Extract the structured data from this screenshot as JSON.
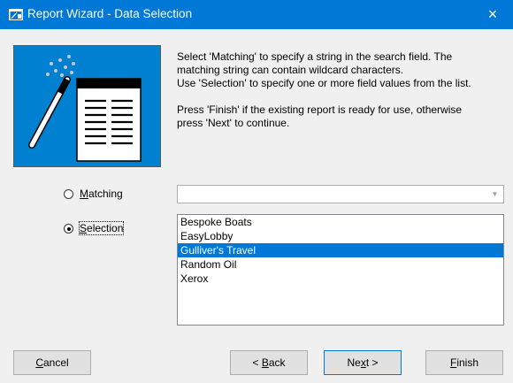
{
  "window": {
    "title": "Report Wizard - Data Selection",
    "close_glyph": "×"
  },
  "description": {
    "line1": "Select 'Matching' to specify a string in the search field.  The",
    "line2": "matching string can contain wildcard characters.",
    "line3": "Use 'Selection' to specify one or more field values from the list.",
    "line4": "Press 'Finish' if the existing report is ready for use, otherwise",
    "line5": "press 'Next' to continue."
  },
  "options": {
    "matching": {
      "label_pre": "",
      "label_u": "M",
      "label_post": "atching",
      "checked": false
    },
    "selection": {
      "label_pre": "",
      "label_u": "S",
      "label_post": "election",
      "checked": true
    }
  },
  "matching_combo": {
    "value": ""
  },
  "selection_list": {
    "items": [
      "Bespoke Boats",
      "EasyLobby",
      "Gulliver's Travel",
      "Random Oil",
      "Xerox"
    ],
    "selected_index": 2
  },
  "buttons": {
    "cancel": {
      "pre": "",
      "u": "C",
      "post": "ancel"
    },
    "back": {
      "pre": "< ",
      "u": "B",
      "post": "ack"
    },
    "next": {
      "pre": "Ne",
      "u": "x",
      "post": "t >"
    },
    "finish": {
      "pre": "",
      "u": "F",
      "post": "inish"
    }
  },
  "icons": {
    "app": "wizard-app-icon",
    "close": "close-icon",
    "art": "wizard-wand-report-icon",
    "combo_arrow": "chevron-down-icon"
  },
  "colors": {
    "titlebar": "#0078d7",
    "art_background": "#0080d0",
    "selection_highlight": "#0078d7",
    "dialog_background": "#f0f0f0"
  }
}
